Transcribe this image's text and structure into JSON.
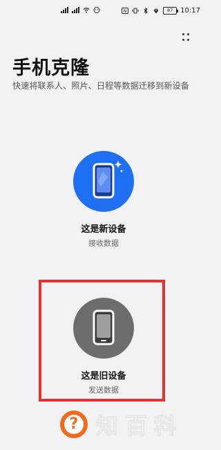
{
  "status_bar": {
    "left_icons": [
      "signal-1-icon",
      "signal-2-icon",
      "wifi-icon",
      "wechat-icon"
    ],
    "right_icons": [
      "nfc-icon",
      "vibrate-icon",
      "bluetooth-icon",
      "location-icon"
    ],
    "battery": "87",
    "time": "10:17"
  },
  "header": {
    "title": "手机克隆",
    "subtitle": "快速将联系人、照片、日程等数据迁移到新设备",
    "menu_icon": "more-vert-icon"
  },
  "options": [
    {
      "title": "这是新设备",
      "subtitle": "接收数据",
      "icon": "phone-icon",
      "color": "#1f6ff2"
    },
    {
      "title": "这是旧设备",
      "subtitle": "发送数据",
      "icon": "phone-icon",
      "color": "#6d6d70"
    }
  ],
  "colors": {
    "highlight": "#e8312f",
    "background": "#f2f2f4"
  },
  "watermark": {
    "text": "知百科",
    "badge": "?"
  }
}
